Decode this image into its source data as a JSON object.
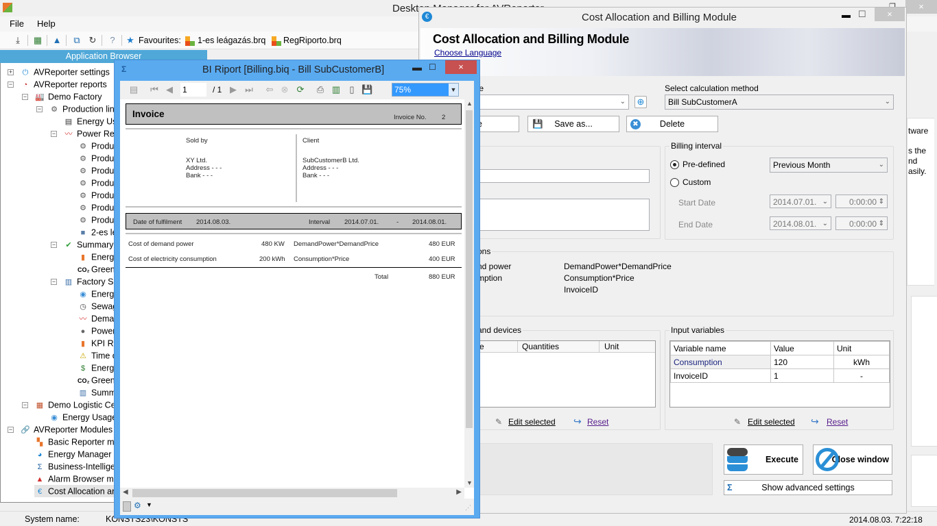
{
  "main_window": {
    "title": "Desktop Manager for AVReporter",
    "close": "×",
    "restore": "❐",
    "menu": [
      "File",
      "Help"
    ],
    "toolbar": {
      "favourites_label": "Favourites:",
      "favourites": [
        "1-es leágazás.brq",
        "RegRiporto.brq"
      ]
    },
    "right_partial_text": [
      "tware",
      "s the",
      "nd",
      "asily."
    ]
  },
  "app_browser": {
    "header": "Application Browser",
    "tree": [
      {
        "label": "AVReporter settings",
        "icon": "plug-icon",
        "level": 0,
        "expander": "+"
      },
      {
        "label": "AVReporter reports",
        "icon": "pie-chart-icon",
        "level": 0,
        "expander": "−"
      },
      {
        "label": "Demo Factory",
        "icon": "factory-icon",
        "level": 1,
        "expander": "−"
      },
      {
        "label": "Production lin",
        "icon": "gear-icon",
        "level": 2,
        "expander": "−"
      },
      {
        "label": "Energy Us",
        "icon": "document-icon",
        "level": 3
      },
      {
        "label": "Power Re",
        "icon": "line-chart-icon",
        "level": 3,
        "expander": "−"
      },
      {
        "label": "Produ",
        "icon": "gear-icon",
        "level": 4
      },
      {
        "label": "Produ",
        "icon": "gear-icon",
        "level": 4
      },
      {
        "label": "Produ",
        "icon": "gear-icon",
        "level": 4
      },
      {
        "label": "Produ",
        "icon": "gear-icon",
        "level": 4
      },
      {
        "label": "Produ",
        "icon": "gear-icon",
        "level": 4
      },
      {
        "label": "Produ",
        "icon": "gear-icon",
        "level": 4
      },
      {
        "label": "Produ",
        "icon": "gear-icon",
        "level": 4
      },
      {
        "label": "2-es le",
        "icon": "cube-icon",
        "level": 4
      },
      {
        "label": "Summary",
        "icon": "check-icon",
        "level": 3,
        "expander": "−"
      },
      {
        "label": "Energ",
        "icon": "bar-chart-icon",
        "level": 4
      },
      {
        "label": "Green",
        "icon": "co2-icon",
        "level": 4
      },
      {
        "label": "Factory Su",
        "icon": "monitor-chart-icon",
        "level": 3,
        "expander": "−"
      },
      {
        "label": "Energ",
        "icon": "meter-icon",
        "level": 4
      },
      {
        "label": "Sewag",
        "icon": "gauge-icon",
        "level": 4
      },
      {
        "label": "Dema",
        "icon": "line-chart-icon",
        "level": 4
      },
      {
        "label": "Power",
        "icon": "cylinder-icon",
        "level": 4
      },
      {
        "label": "KPI Re",
        "icon": "bar-chart-icon",
        "level": 4
      },
      {
        "label": "Time o",
        "icon": "warning-chart-icon",
        "level": 4
      },
      {
        "label": "Energ",
        "icon": "money-icon",
        "level": 4
      },
      {
        "label": "Green",
        "icon": "co2-icon",
        "level": 4
      },
      {
        "label": "Summ",
        "icon": "monitor-chart-icon",
        "level": 4
      },
      {
        "label": "Demo Logistic Ce",
        "icon": "warehouse-icon",
        "level": 1,
        "expander": "−"
      },
      {
        "label": "Energy Usage",
        "icon": "meter-icon",
        "level": 2
      },
      {
        "label": "AVReporter Modules",
        "icon": "link-icon",
        "level": 0,
        "expander": "−"
      },
      {
        "label": "Basic Reporter m",
        "icon": "blocks-icon",
        "level": 1
      },
      {
        "label": "Energy Manager S",
        "icon": "pie-icon",
        "level": 1
      },
      {
        "label": "Business-Intellige",
        "icon": "sigma-icon",
        "level": 1
      },
      {
        "label": "Alarm Browser m",
        "icon": "alarm-icon",
        "level": 1
      },
      {
        "label": "Cost Allocation ar",
        "icon": "euro-icon",
        "level": 1,
        "selected": true
      }
    ]
  },
  "status_bar": {
    "system_name_label": "System name:",
    "system_name_value": "KONSTS23\\KONSTS",
    "datetime": "2014.08.03. 7:22:18"
  },
  "bi_window": {
    "title": "BI Riport [Billing.biq - Bill SubCustomerB]",
    "page_current": "1",
    "page_total": "/ 1",
    "zoom": "75%",
    "invoice": {
      "title": "Invoice",
      "invoice_no_label": "Invoice No.",
      "invoice_no": "2",
      "sold_by_label": "Sold by",
      "seller": [
        "XY Ltd.",
        "Address - - -",
        "Bank - - -"
      ],
      "client_label": "Client",
      "client": [
        "SubCustomerB Ltd.",
        "Address - - -",
        "Bank - - -"
      ],
      "fulfilment_label": "Date of fulfilment",
      "fulfilment_date": "2014.08.03.",
      "interval_label": "Interval",
      "interval_start": "2014.07.01.",
      "interval_sep": "-",
      "interval_end": "2014.08.01.",
      "lines": [
        {
          "name": "Cost of demand power",
          "qty": "480 KW",
          "formula": "DemandPower*DemandPrice",
          "amount": "480 EUR"
        },
        {
          "name": "Cost of electricity consumption",
          "qty": "200 kWh",
          "formula": "Consumption*Price",
          "amount": "400 EUR"
        }
      ],
      "total_label": "Total",
      "total": "880 EUR"
    }
  },
  "cost_window": {
    "title": "Cost Allocation and Billing Module",
    "banner_title": "Cost Allocation and Billing Module",
    "choose_language": "Choose Language",
    "template_label_partial": "te",
    "calc_method_label": "Select calculation method",
    "calc_method_value": "Bill SubCustomerA",
    "save_partial": "e",
    "save_as": "Save as...",
    "delete": "Delete",
    "billing_interval": {
      "caption": "Billing interval",
      "predefined_label": "Pre-defined",
      "predefined_selected": true,
      "predefined_value": "Previous Month",
      "custom_label": "Custom",
      "start_label": "Start Date",
      "start_date": "2014.07.01.",
      "start_time": "0:00:00",
      "end_label": "End Date",
      "end_date": "2014.08.01.",
      "end_time": "0:00:00"
    },
    "functions": {
      "caption_partial": "ons",
      "rows": [
        {
          "name_partial": "nd power",
          "formula": "DemandPower*DemandPrice"
        },
        {
          "name_partial": "mption",
          "formula": "Consumption*Price"
        },
        {
          "name_partial": "",
          "formula": "InvoiceID"
        }
      ]
    },
    "devices": {
      "caption_partial": "and devices",
      "columns": [
        "e",
        "Quantities",
        "Unit"
      ],
      "edit_selected": "Edit selected",
      "reset": "Reset"
    },
    "input_variables": {
      "caption": "Input variables",
      "columns": [
        "Variable name",
        "Value",
        "Unit"
      ],
      "rows": [
        {
          "name": "Consumption",
          "value": "120",
          "unit": "kWh"
        },
        {
          "name": "InvoiceID",
          "value": "1",
          "unit": "-"
        }
      ],
      "edit_selected": "Edit selected",
      "reset": "Reset"
    },
    "execute": "Execute",
    "close_window": "Close window",
    "advanced": "Show advanced settings"
  }
}
